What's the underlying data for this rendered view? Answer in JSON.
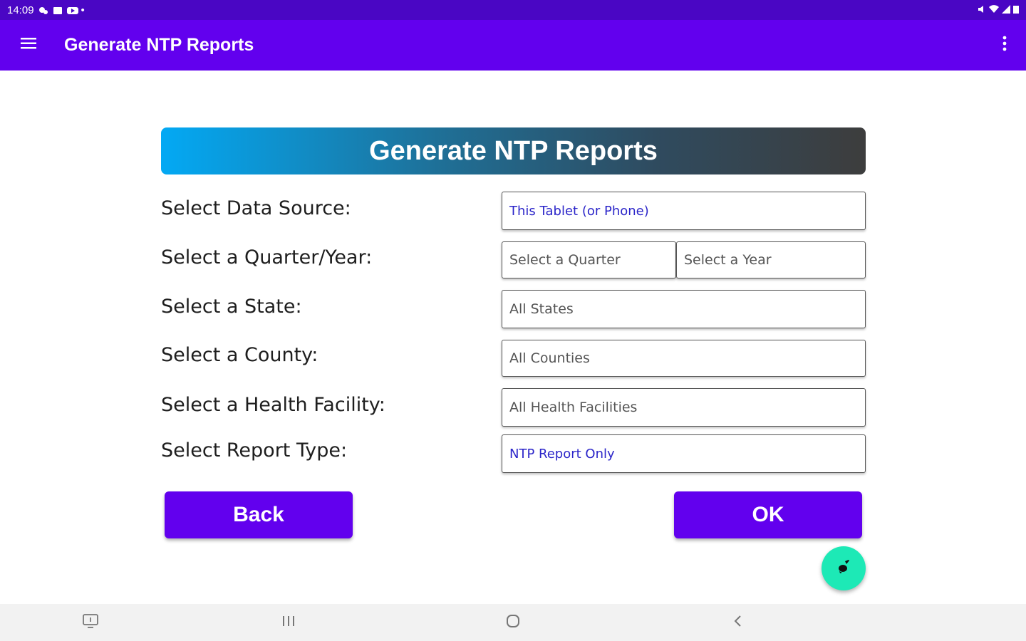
{
  "status_bar": {
    "time": "14:09"
  },
  "app_bar": {
    "title": "Generate NTP Reports"
  },
  "banner": {
    "title": "Generate NTP Reports"
  },
  "form": {
    "data_source": {
      "label": "Select Data Source:",
      "value": "This Tablet (or Phone)"
    },
    "quarter_year": {
      "label": "Select a Quarter/Year:",
      "quarter_placeholder": "Select a Quarter",
      "year_placeholder": "Select a Year"
    },
    "state": {
      "label": "Select a State:",
      "value": "All States"
    },
    "county": {
      "label": "Select a County:",
      "value": "All Counties"
    },
    "facility": {
      "label": "Select a Health Facility:",
      "value": "All Health Facilities"
    },
    "report_type": {
      "label": "Select Report Type:",
      "value": "NTP Report Only"
    }
  },
  "buttons": {
    "back": "Back",
    "ok": "OK"
  },
  "colors": {
    "primary": "#6200ee",
    "status_bar": "#4a06c4",
    "fab": "#1de9b6",
    "accent_text": "#2b25c9"
  },
  "icons": {
    "menu": "menu-icon",
    "overflow": "more-vert-icon",
    "fab": "brush-icon",
    "nav_recents_app": "screenshot-icon",
    "nav_recents": "recents-icon",
    "nav_home": "home-icon",
    "nav_back": "back-icon"
  }
}
